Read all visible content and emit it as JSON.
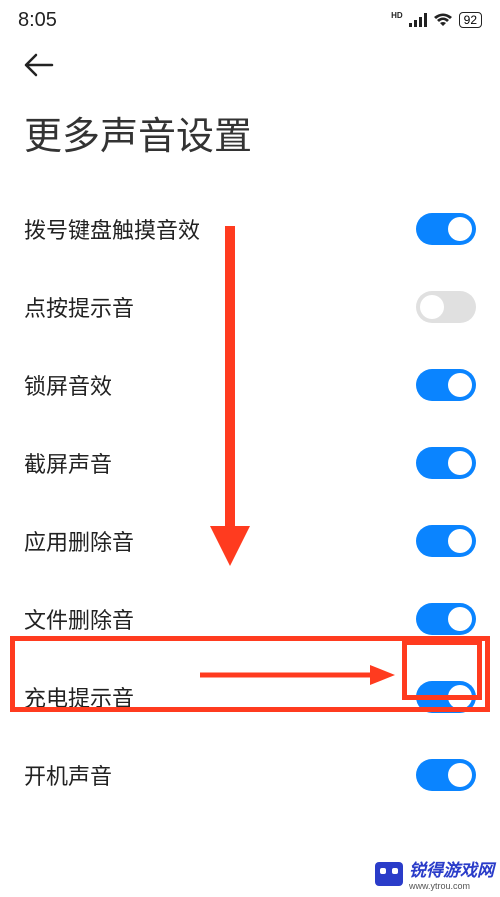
{
  "status": {
    "time": "8:05",
    "hd": "HD",
    "battery": "92"
  },
  "page_title": "更多声音设置",
  "settings": [
    {
      "label": "拨号键盘触摸音效",
      "on": true
    },
    {
      "label": "点按提示音",
      "on": false
    },
    {
      "label": "锁屏音效",
      "on": true
    },
    {
      "label": "截屏声音",
      "on": true
    },
    {
      "label": "应用删除音",
      "on": true
    },
    {
      "label": "文件删除音",
      "on": true
    },
    {
      "label": "充电提示音",
      "on": true
    },
    {
      "label": "开机声音",
      "on": true
    }
  ],
  "watermark": {
    "text": "锐得游戏网",
    "sub": "www.ytrou.com"
  }
}
